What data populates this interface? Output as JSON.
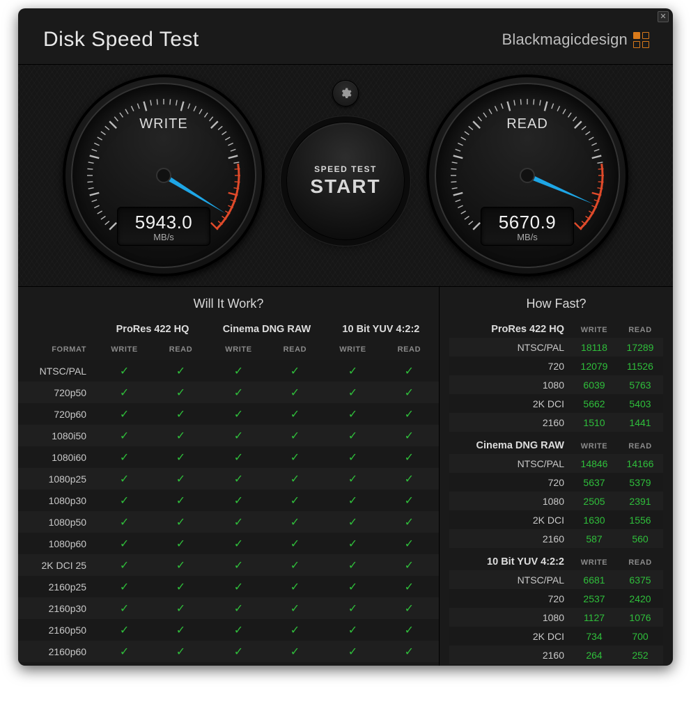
{
  "app": {
    "title": "Disk Speed Test",
    "brand": "Blackmagicdesign"
  },
  "controls": {
    "start_small": "SPEED TEST",
    "start_big": "START"
  },
  "gauges": {
    "write": {
      "label": "WRITE",
      "value": "5943.0",
      "unit": "MB/s",
      "frac": 0.95
    },
    "read": {
      "label": "READ",
      "value": "5670.9",
      "unit": "MB/s",
      "frac": 0.92
    }
  },
  "wiw": {
    "title": "Will It Work?",
    "format_header": "FORMAT",
    "codecs": [
      "ProRes 422 HQ",
      "Cinema DNG RAW",
      "10 Bit YUV 4:2:2"
    ],
    "wr": "WRITE",
    "rd": "READ",
    "rows": [
      {
        "fmt": "NTSC/PAL",
        "v": [
          true,
          true,
          true,
          true,
          true,
          true
        ]
      },
      {
        "fmt": "720p50",
        "v": [
          true,
          true,
          true,
          true,
          true,
          true
        ]
      },
      {
        "fmt": "720p60",
        "v": [
          true,
          true,
          true,
          true,
          true,
          true
        ]
      },
      {
        "fmt": "1080i50",
        "v": [
          true,
          true,
          true,
          true,
          true,
          true
        ]
      },
      {
        "fmt": "1080i60",
        "v": [
          true,
          true,
          true,
          true,
          true,
          true
        ]
      },
      {
        "fmt": "1080p25",
        "v": [
          true,
          true,
          true,
          true,
          true,
          true
        ]
      },
      {
        "fmt": "1080p30",
        "v": [
          true,
          true,
          true,
          true,
          true,
          true
        ]
      },
      {
        "fmt": "1080p50",
        "v": [
          true,
          true,
          true,
          true,
          true,
          true
        ]
      },
      {
        "fmt": "1080p60",
        "v": [
          true,
          true,
          true,
          true,
          true,
          true
        ]
      },
      {
        "fmt": "2K DCI 25",
        "v": [
          true,
          true,
          true,
          true,
          true,
          true
        ]
      },
      {
        "fmt": "2160p25",
        "v": [
          true,
          true,
          true,
          true,
          true,
          true
        ]
      },
      {
        "fmt": "2160p30",
        "v": [
          true,
          true,
          true,
          true,
          true,
          true
        ]
      },
      {
        "fmt": "2160p50",
        "v": [
          true,
          true,
          true,
          true,
          true,
          true
        ]
      },
      {
        "fmt": "2160p60",
        "v": [
          true,
          true,
          true,
          true,
          true,
          true
        ]
      }
    ]
  },
  "hf": {
    "title": "How Fast?",
    "wr": "WRITE",
    "rd": "READ",
    "groups": [
      {
        "codec": "ProRes 422 HQ",
        "rows": [
          {
            "fmt": "NTSC/PAL",
            "w": "18118",
            "r": "17289"
          },
          {
            "fmt": "720",
            "w": "12079",
            "r": "11526"
          },
          {
            "fmt": "1080",
            "w": "6039",
            "r": "5763"
          },
          {
            "fmt": "2K DCI",
            "w": "5662",
            "r": "5403"
          },
          {
            "fmt": "2160",
            "w": "1510",
            "r": "1441"
          }
        ]
      },
      {
        "codec": "Cinema DNG RAW",
        "rows": [
          {
            "fmt": "NTSC/PAL",
            "w": "14846",
            "r": "14166"
          },
          {
            "fmt": "720",
            "w": "5637",
            "r": "5379"
          },
          {
            "fmt": "1080",
            "w": "2505",
            "r": "2391"
          },
          {
            "fmt": "2K DCI",
            "w": "1630",
            "r": "1556"
          },
          {
            "fmt": "2160",
            "w": "587",
            "r": "560"
          }
        ]
      },
      {
        "codec": "10 Bit YUV 4:2:2",
        "rows": [
          {
            "fmt": "NTSC/PAL",
            "w": "6681",
            "r": "6375"
          },
          {
            "fmt": "720",
            "w": "2537",
            "r": "2420"
          },
          {
            "fmt": "1080",
            "w": "1127",
            "r": "1076"
          },
          {
            "fmt": "2K DCI",
            "w": "734",
            "r": "700"
          },
          {
            "fmt": "2160",
            "w": "264",
            "r": "252"
          }
        ]
      }
    ]
  }
}
